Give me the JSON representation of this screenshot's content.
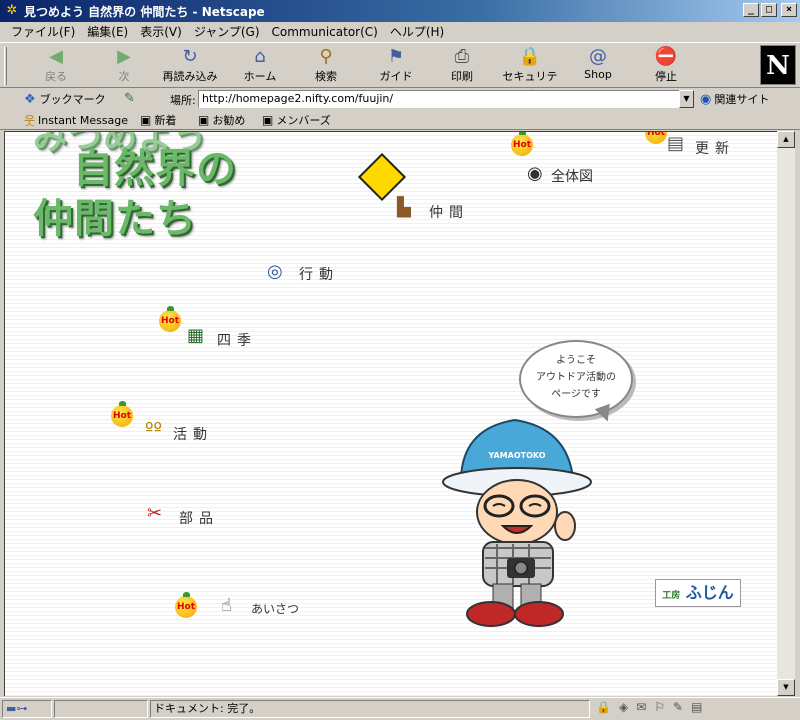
{
  "window": {
    "title": "見つめよう 自然界の 仲間たち - Netscape",
    "buttons": [
      "_",
      "□",
      "×"
    ]
  },
  "menubar": [
    "ファイル(F)",
    "編集(E)",
    "表示(V)",
    "ジャンプ(G)",
    "Communicator(C)",
    "ヘルプ(H)"
  ],
  "toolbar": {
    "back": "戻る",
    "forward": "次",
    "reload": "再読み込み",
    "home": "ホーム",
    "search": "検索",
    "guide": "ガイド",
    "print": "印刷",
    "security": "セキュリティ",
    "shop": "Shop",
    "stop": "停止",
    "logo": "N"
  },
  "locationbar": {
    "bookmarks": "ブックマーク",
    "label": "場所:",
    "url": "http://homepage2.nifty.com/fuujin/",
    "related": "関連サイト"
  },
  "personalbar": {
    "instant_message": "Instant Message",
    "new": "新着",
    "recommend": "お勧め",
    "members": "メンバーズ"
  },
  "content": {
    "logo_top": "みつめよう",
    "logo_line1": "自然界の",
    "logo_line2": "仲間たち",
    "hot_label": "Hot",
    "links": {
      "update": "更新",
      "overview": "全体図",
      "companions": "仲間",
      "action": "行動",
      "seasons": "四季",
      "activities": "活動",
      "parts": "部品",
      "greeting": "あいさつ"
    },
    "bubble": {
      "line1": "ようこそ",
      "line2": "アウトドア活動の",
      "line3": "ページです"
    },
    "cap_text": "YAMAOTOKO",
    "footer_logo_small": "工房",
    "footer_logo": "ふじん"
  },
  "statusbar": {
    "status": "ドキュメント: 完了。"
  }
}
